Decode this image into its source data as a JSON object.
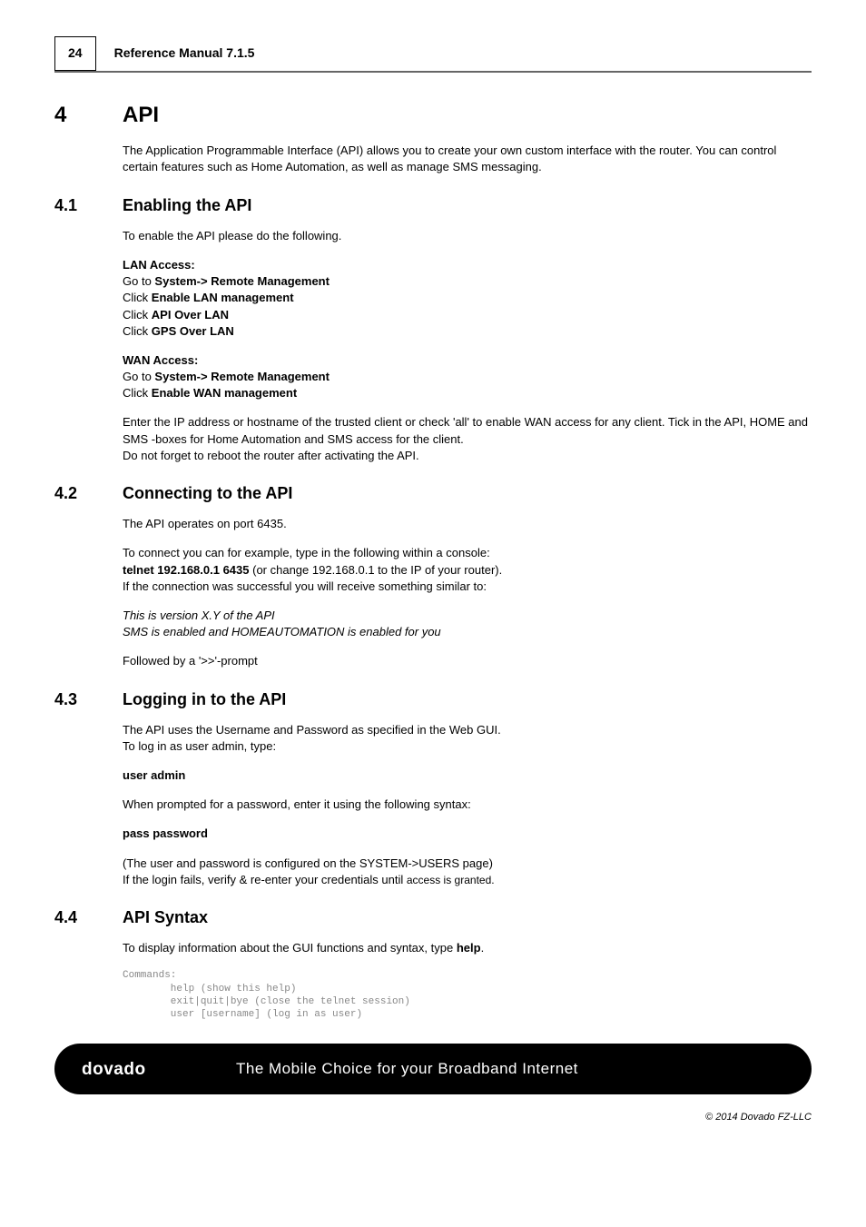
{
  "header": {
    "page_number": "24",
    "title": "Reference Manual 7.1.5"
  },
  "sections": {
    "s4": {
      "num": "4",
      "title": "API",
      "intro": "The Application Programmable Interface (API) allows you to create your own custom interface with the router. You can control certain features such as Home Automation, as well as manage SMS messaging."
    },
    "s41": {
      "num": "4.1",
      "title": "Enabling the API",
      "p1": "To enable the API please do the following.",
      "lan_block": {
        "l1": "LAN Access:",
        "l2_pre": "Go to ",
        "l2_b": "System-> Remote Management",
        "l3_pre": "Click ",
        "l3_b": "Enable LAN management",
        "l4_pre": "Click ",
        "l4_b": "API Over LAN",
        "l5_pre": "Click ",
        "l5_b": "GPS Over LAN"
      },
      "wan_block": {
        "l1": "WAN Access:",
        "l2_pre": "Go to ",
        "l2_b": "System-> Remote Management",
        "l3_pre": "Click ",
        "l3_b": "Enable WAN management"
      },
      "p2": "Enter the IP address or hostname of the trusted client or check 'all' to enable WAN access for any client. Tick in the API, HOME and SMS -boxes for Home Automation and SMS access for the client.",
      "p3": "Do not forget to reboot the router after activating the API."
    },
    "s42": {
      "num": "4.2",
      "title": "Connecting to the API",
      "p1": "The API operates on port 6435.",
      "p2_pre": "To connect you can for example, type in the following within a console:",
      "p2_bold": "telnet 192.168.0.1 6435",
      "p2_post": " (or change 192.168.0.1 to the IP of your router).",
      "p2_line3": "If the connection was successful you will receive something similar to:",
      "p3_l1": "This is version X.Y of the API",
      "p3_l2": "SMS is enabled and HOMEAUTOMATION is enabled for you",
      "p4": "Followed by a '>>'-prompt"
    },
    "s43": {
      "num": "4.3",
      "title": "Logging in to the API",
      "p1": "The API uses the Username and Password as specified in the Web GUI.",
      "p1b": "To log in as user admin, type:",
      "cmd1": "user admin",
      "p2": "When prompted for a password, enter it using the following syntax:",
      "cmd2": "pass password",
      "p3": "(The user and password is configured on the SYSTEM->USERS page)",
      "p3b_pre": "If the login fails, verify & re-enter your credentials until ",
      "p3b_sm": "access is granted."
    },
    "s44": {
      "num": "4.4",
      "title": "API Syntax",
      "p1_pre": "To display information about the GUI functions and syntax, type ",
      "p1_b": "help",
      "p1_post": ".",
      "code": "Commands:\n        help (show this help)\n        exit|quit|bye (close the telnet session)\n        user [username] (log in as user)"
    }
  },
  "footer": {
    "slogan": "The Mobile Choice for your Broadband Internet",
    "copyright": "© 2014 Dovado FZ-LLC"
  }
}
